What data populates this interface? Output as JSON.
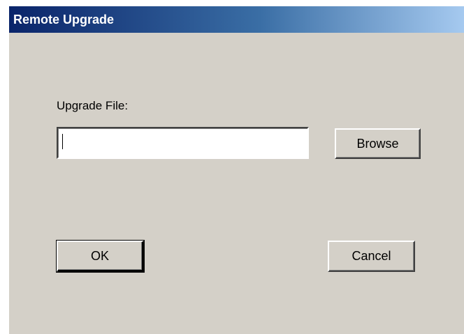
{
  "window": {
    "title": "Remote Upgrade"
  },
  "form": {
    "upgrade_file_label": "Upgrade File:",
    "upgrade_file_value": ""
  },
  "buttons": {
    "browse_label": "Browse",
    "ok_label": "OK",
    "cancel_label": "Cancel"
  },
  "colors": {
    "titlebar_start": "#0a246a",
    "titlebar_end": "#a6caf0",
    "dialog_face": "#d4d0c8"
  }
}
